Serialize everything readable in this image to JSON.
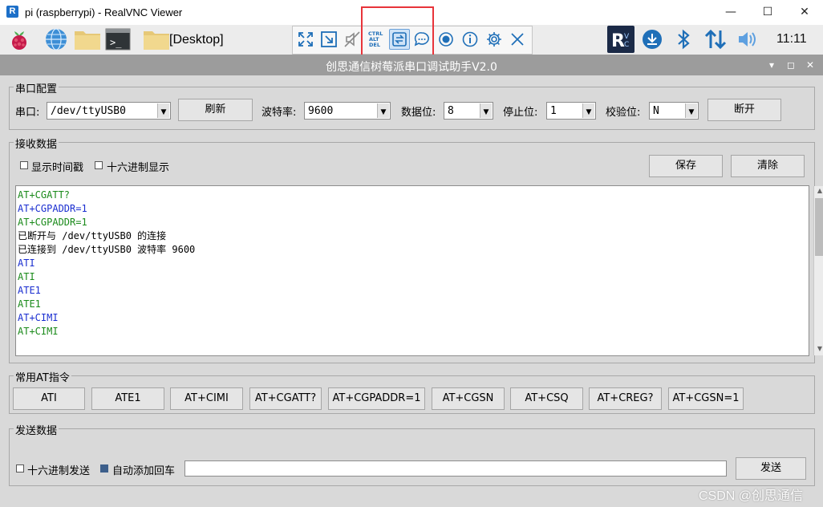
{
  "window": {
    "title": "pi (raspberrypi) - RealVNC Viewer",
    "icon_letter": "R"
  },
  "window_buttons": {
    "minimize": "—",
    "maximize": "☐",
    "close": "✕"
  },
  "vnc_toolbar": {
    "desktop_label": "[Desktop]",
    "ctrl_alt_del": [
      "CTRL",
      "ALT",
      "DEL"
    ],
    "clock": "11:11"
  },
  "app": {
    "title": "创思通信树莓派串口调试助手V2.0",
    "title_buttons": {
      "collapse": "▾",
      "restore": "◻",
      "close": "✕"
    }
  },
  "serial_config": {
    "group_label": "串口配置",
    "port_label": "串口:",
    "port_value": "/dev/ttyUSB0",
    "refresh_button": "刷新",
    "baud_label": "波特率:",
    "baud_value": "9600",
    "databits_label": "数据位:",
    "databits_value": "8",
    "stopbits_label": "停止位:",
    "stopbits_value": "1",
    "parity_label": "校验位:",
    "parity_value": "N",
    "disconnect_button": "断开"
  },
  "receive": {
    "group_label": "接收数据",
    "show_timestamp_label": "显示时间戳",
    "show_timestamp_checked": false,
    "hex_display_label": "十六进制显示",
    "hex_display_checked": false,
    "save_button": "保存",
    "clear_button": "清除",
    "lines": [
      {
        "text": "AT+CGATT?",
        "color": "#1a8a1a"
      },
      {
        "text": "AT+CGPADDR=1",
        "color": "#1a2ed0"
      },
      {
        "text": "AT+CGPADDR=1",
        "color": "#1a8a1a"
      },
      {
        "text": "已断开与 /dev/ttyUSB0 的连接",
        "color": "#000000"
      },
      {
        "text": "已连接到 /dev/ttyUSB0 波特率 9600",
        "color": "#000000"
      },
      {
        "text": "ATI",
        "color": "#1a2ed0"
      },
      {
        "text": "ATI",
        "color": "#1a8a1a"
      },
      {
        "text": "ATE1",
        "color": "#1a2ed0"
      },
      {
        "text": "ATE1",
        "color": "#1a8a1a"
      },
      {
        "text": "AT+CIMI",
        "color": "#1a2ed0"
      },
      {
        "text": "AT+CIMI",
        "color": "#1a8a1a"
      }
    ]
  },
  "at_commands": {
    "group_label": "常用AT指令",
    "buttons": [
      "ATI",
      "ATE1",
      "AT+CIMI",
      "AT+CGATT?",
      "AT+CGPADDR=1",
      "AT+CGSN",
      "AT+CSQ",
      "AT+CREG?",
      "AT+CGSN=1"
    ]
  },
  "send": {
    "group_label": "发送数据",
    "hex_send_label": "十六进制发送",
    "hex_send_checked": false,
    "auto_newline_label": "自动添加回车",
    "auto_newline_checked": true,
    "input_value": "",
    "send_button": "发送"
  },
  "watermark": "CSDN @创思通信",
  "colors": {
    "highlight_box": "#e8343a",
    "rx_green": "#1a8a1a",
    "tx_blue": "#1a2ed0"
  }
}
